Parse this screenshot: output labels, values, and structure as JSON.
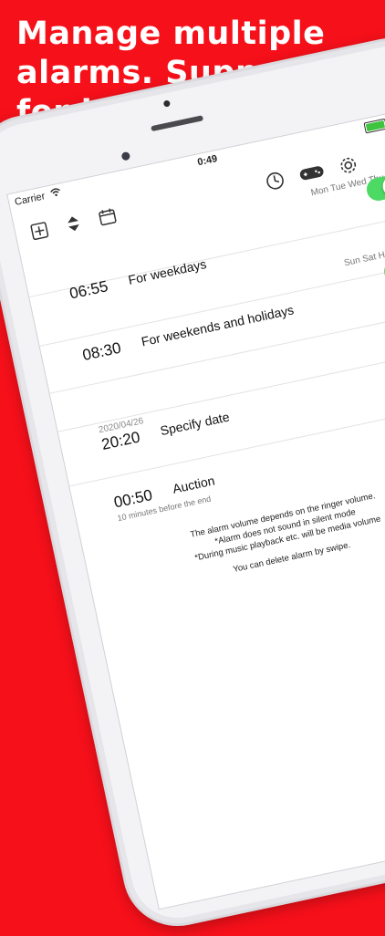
{
  "headline": {
    "line1": "Manage multiple",
    "line2": "alarms. Support",
    "line3": "for holidays."
  },
  "status_bar": {
    "carrier": "Carrier",
    "time": "0:49"
  },
  "toolbar": {
    "icons": [
      "add-icon",
      "reorder-icon",
      "calendar-icon",
      "clock-icon",
      "gamepad-icon",
      "gear-icon"
    ]
  },
  "alarms": [
    {
      "days": "Mon Tue Wed Thu Fri",
      "date": "",
      "time": "06:55",
      "label": "For weekdays",
      "sub": "",
      "enabled": true
    },
    {
      "days": "Sun Sat Holidays",
      "date": "",
      "time": "08:30",
      "label": "For weekends and holidays",
      "sub": "",
      "enabled": true
    },
    {
      "days": "",
      "date": "",
      "time": "",
      "label": "",
      "sub": "",
      "enabled": true
    },
    {
      "days": "",
      "date": "2020/04/26",
      "time": "20:20",
      "label": "Specify date",
      "sub": "",
      "enabled": true
    },
    {
      "days": "",
      "date": "",
      "time": "00:50",
      "label": "Auction",
      "sub": "10 minutes before the end",
      "enabled": null
    }
  ],
  "notes": {
    "line1": "The alarm volume depends on the ringer volume.",
    "line2": "*Alarm does not sound in silent mode",
    "line3": "*During music playback etc. will be media volume",
    "line4": "You can delete alarm by swipe."
  },
  "colors": {
    "background": "#f6101a",
    "toggle_on": "#4cd964"
  }
}
